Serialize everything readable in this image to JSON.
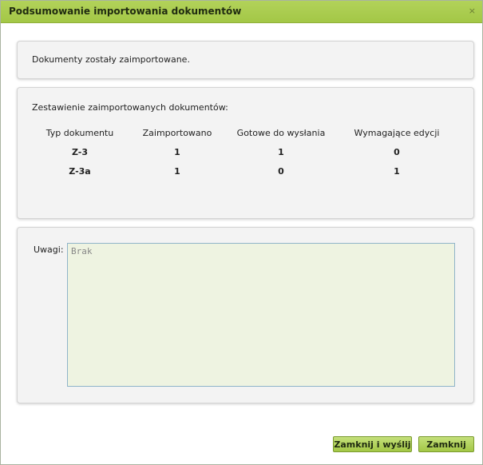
{
  "dialog": {
    "title": "Podsumowanie importowania dokumentów",
    "close_icon": "×"
  },
  "status": {
    "message": "Dokumenty zostały zaimportowane."
  },
  "summary": {
    "title": "Zestawienie zaimportowanych dokumentów:",
    "headers": [
      "Typ dokumentu",
      "Zaimportowano",
      "Gotowe do wysłania",
      "Wymagające edycji"
    ],
    "rows": [
      [
        "Z-3",
        "1",
        "1",
        "0"
      ],
      [
        "Z-3a",
        "1",
        "0",
        "1"
      ]
    ]
  },
  "notes": {
    "label": "Uwagi:",
    "value": "Brak"
  },
  "buttons": {
    "close_and_send": "Zamknij i wyślij",
    "close": "Zamknij"
  },
  "colors": {
    "titlebar": "#a3c746",
    "button": "#a3c746",
    "notes_background": "#eef3e1"
  }
}
